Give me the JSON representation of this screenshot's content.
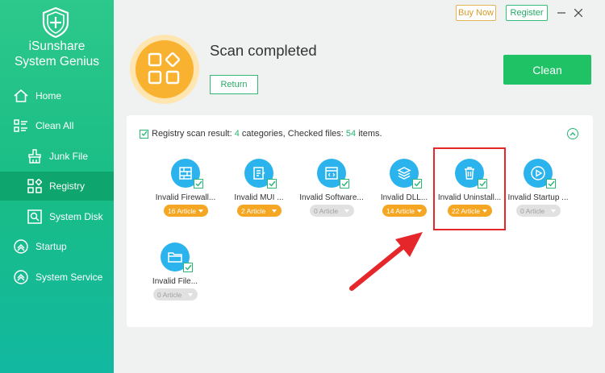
{
  "app": {
    "name_line1": "iSunshare",
    "name_line2": "System Genius"
  },
  "sidebar": {
    "items": [
      {
        "label": "Home",
        "icon": "home-icon"
      },
      {
        "label": "Clean All",
        "icon": "clean-all-icon"
      },
      {
        "label": "Junk File",
        "icon": "junk-file-icon"
      },
      {
        "label": "Registry",
        "icon": "registry-icon"
      },
      {
        "label": "System Disk",
        "icon": "system-disk-icon"
      },
      {
        "label": "Startup",
        "icon": "startup-icon"
      },
      {
        "label": "System Service",
        "icon": "system-service-icon"
      }
    ],
    "active": "Registry"
  },
  "header": {
    "buy_label": "Buy Now",
    "register_label": "Register"
  },
  "scan": {
    "title": "Scan completed",
    "return_label": "Return",
    "clean_label": "Clean"
  },
  "summary": {
    "prefix": "Registry scan result:",
    "categories_count": "4",
    "categories_text": "categories, Checked files:",
    "files_count": "54",
    "files_text": "items."
  },
  "categories": [
    {
      "name": "Invalid Firewall...",
      "count": "16 Article",
      "state": "orange",
      "icon": "firewall-icon"
    },
    {
      "name": "Invalid MUI ...",
      "count": "2 Article",
      "state": "orange",
      "icon": "mui-icon"
    },
    {
      "name": "Invalid Software...",
      "count": "0 Article",
      "state": "gray",
      "icon": "software-icon"
    },
    {
      "name": "Invalid DLL...",
      "count": "14 Article",
      "state": "orange",
      "icon": "dll-icon"
    },
    {
      "name": "Invalid Uninstall...",
      "count": "22 Article",
      "state": "orange",
      "icon": "trash-icon"
    },
    {
      "name": "Invalid Startup ...",
      "count": "0 Article",
      "state": "gray",
      "icon": "startup-play-icon"
    },
    {
      "name": "Invalid File...",
      "count": "0 Article",
      "state": "gray",
      "icon": "folder-icon"
    }
  ],
  "colors": {
    "accent": "#2bb673",
    "orange": "#f5a623",
    "blue": "#2bb3ee",
    "annotation": "#e5262a"
  }
}
